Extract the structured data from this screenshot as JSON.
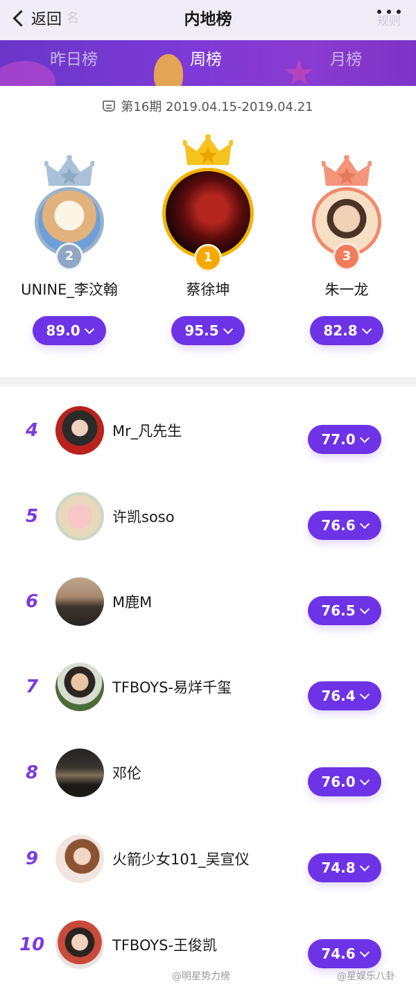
{
  "nav": {
    "back_label": "返回",
    "title": "内地榜",
    "ghost_left": "名",
    "ghost_right": "规则"
  },
  "tabs": [
    {
      "label": "昨日榜",
      "active": false
    },
    {
      "label": "周榜",
      "active": true
    },
    {
      "label": "月榜",
      "active": false
    }
  ],
  "period": "第16期 2019.04.15-2019.04.21",
  "podium": [
    {
      "rank": "2",
      "name": "UNINE_李汶翰",
      "score": "89.0",
      "crown_color": "#a9c1d9",
      "ring_color": "#9ab2cc",
      "medal_color": "#8fa6c4"
    },
    {
      "rank": "1",
      "name": "蔡徐坤",
      "score": "95.5",
      "crown_color": "#f6c21e",
      "ring_color": "#f4b400",
      "medal_color": "#f5a900"
    },
    {
      "rank": "3",
      "name": "朱一龙",
      "score": "82.8",
      "crown_color": "#f2957b",
      "ring_color": "#f08a6b",
      "medal_color": "#ef7d5c"
    }
  ],
  "list": [
    {
      "rank": "4",
      "name": "Mr_凡先生",
      "score": "77.0"
    },
    {
      "rank": "5",
      "name": "许凯soso",
      "score": "76.6"
    },
    {
      "rank": "6",
      "name": "M鹿M",
      "score": "76.5"
    },
    {
      "rank": "7",
      "name": "TFBOYS-易烊千玺",
      "score": "76.4"
    },
    {
      "rank": "8",
      "name": "邓伦",
      "score": "76.0"
    },
    {
      "rank": "9",
      "name": "火箭少女101_吴宣仪",
      "score": "74.8"
    },
    {
      "rank": "10",
      "name": "TFBOYS-王俊凯",
      "score": "74.6"
    }
  ],
  "watermarks": [
    "@明星势力榜",
    "@星娱乐八卦"
  ],
  "colors": {
    "accent": "#6d33e6",
    "rank_text": "#7a3be0"
  }
}
